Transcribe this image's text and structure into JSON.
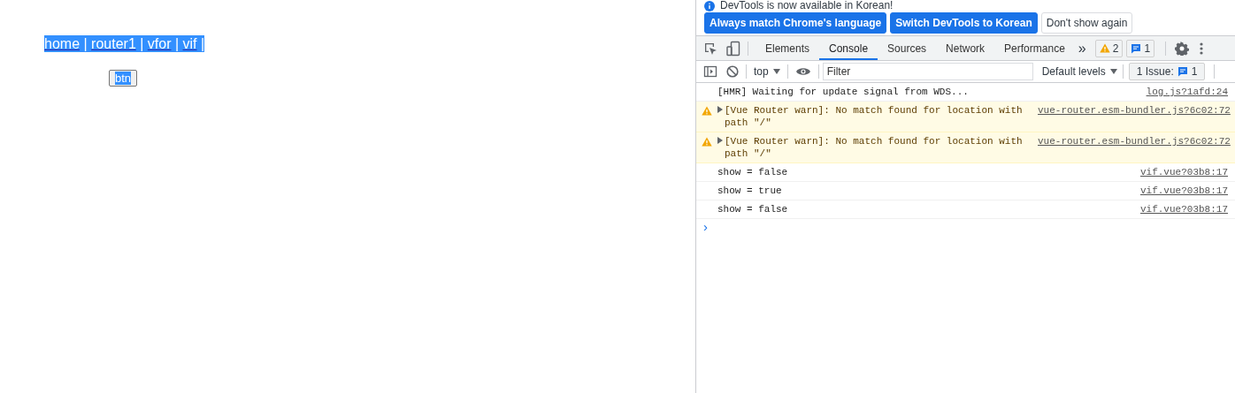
{
  "page": {
    "nav": {
      "highlighted": true,
      "links": [
        "home",
        "router1",
        "vfor",
        "vif"
      ],
      "separator": "|"
    },
    "button": {
      "label": "btn",
      "highlighted": true
    }
  },
  "devtools": {
    "banner": {
      "text": "DevTools is now available in Korean!",
      "buttons": [
        {
          "label": "Always match Chrome's language",
          "kind": "primary"
        },
        {
          "label": "Switch DevTools to Korean",
          "kind": "primary"
        },
        {
          "label": "Don't show again",
          "kind": "plain"
        }
      ]
    },
    "tabs": [
      {
        "label": "Elements",
        "selected": false
      },
      {
        "label": "Console",
        "selected": true
      },
      {
        "label": "Sources",
        "selected": false
      },
      {
        "label": "Network",
        "selected": false
      },
      {
        "label": "Performance",
        "selected": false
      }
    ],
    "more_tabs": "»",
    "warning_count": "2",
    "message_count": "1",
    "toolbar": {
      "context": "top",
      "filter": {
        "placeholder": "Filter"
      },
      "levels": "Default levels",
      "issues_label": "1 Issue:",
      "issues_count": "1"
    },
    "messages": [
      {
        "kind": "log",
        "text": "[HMR] Waiting for update signal from WDS...",
        "source": "log.js?1afd:24"
      },
      {
        "kind": "warn",
        "text": "[Vue Router warn]: No match found for location with path \"/\"",
        "source": "vue-router.esm-bundler.js?6c02:72",
        "expanded": false
      },
      {
        "kind": "warn",
        "text": "[Vue Router warn]: No match found for location with path \"/\"",
        "source": "vue-router.esm-bundler.js?6c02:72",
        "expanded": false
      },
      {
        "kind": "log",
        "text": "show = false",
        "source": "vif.vue?03b8:17"
      },
      {
        "kind": "log",
        "text": "show = true",
        "source": "vif.vue?03b8:17"
      },
      {
        "kind": "log",
        "text": "show = false",
        "source": "vif.vue?03b8:17"
      }
    ],
    "prompt": "›"
  }
}
